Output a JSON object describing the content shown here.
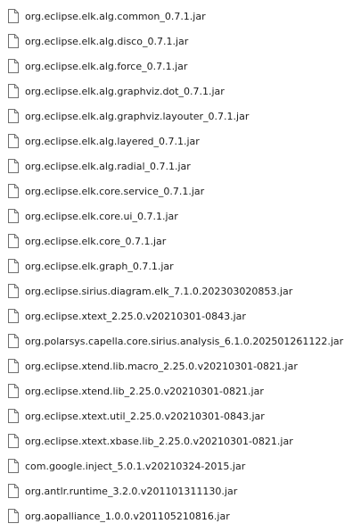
{
  "files": [
    {
      "name": "org.eclipse.elk.alg.common_0.7.1.jar",
      "icon": "file-icon"
    },
    {
      "name": "org.eclipse.elk.alg.disco_0.7.1.jar",
      "icon": "file-icon"
    },
    {
      "name": "org.eclipse.elk.alg.force_0.7.1.jar",
      "icon": "file-icon"
    },
    {
      "name": "org.eclipse.elk.alg.graphviz.dot_0.7.1.jar",
      "icon": "file-icon"
    },
    {
      "name": "org.eclipse.elk.alg.graphviz.layouter_0.7.1.jar",
      "icon": "file-icon"
    },
    {
      "name": "org.eclipse.elk.alg.layered_0.7.1.jar",
      "icon": "file-icon"
    },
    {
      "name": "org.eclipse.elk.alg.radial_0.7.1.jar",
      "icon": "file-icon"
    },
    {
      "name": "org.eclipse.elk.core.service_0.7.1.jar",
      "icon": "file-icon"
    },
    {
      "name": "org.eclipse.elk.core.ui_0.7.1.jar",
      "icon": "file-icon"
    },
    {
      "name": "org.eclipse.elk.core_0.7.1.jar",
      "icon": "file-icon"
    },
    {
      "name": "org.eclipse.elk.graph_0.7.1.jar",
      "icon": "file-icon"
    },
    {
      "name": "org.eclipse.sirius.diagram.elk_7.1.0.202303020853.jar",
      "icon": "file-icon"
    },
    {
      "name": "org.eclipse.xtext_2.25.0.v20210301-0843.jar",
      "icon": "file-icon"
    },
    {
      "name": "org.polarsys.capella.core.sirius.analysis_6.1.0.202501261122.jar",
      "icon": "file-icon"
    },
    {
      "name": "org.eclipse.xtend.lib.macro_2.25.0.v20210301-0821.jar",
      "icon": "file-icon"
    },
    {
      "name": "org.eclipse.xtend.lib_2.25.0.v20210301-0821.jar",
      "icon": "file-icon"
    },
    {
      "name": "org.eclipse.xtext.util_2.25.0.v20210301-0843.jar",
      "icon": "file-icon"
    },
    {
      "name": "org.eclipse.xtext.xbase.lib_2.25.0.v20210301-0821.jar",
      "icon": "file-icon"
    },
    {
      "name": "com.google.inject_5.0.1.v20210324-2015.jar",
      "icon": "file-icon"
    },
    {
      "name": "org.antlr.runtime_3.2.0.v201101311130.jar",
      "icon": "file-icon"
    },
    {
      "name": "org.aopalliance_1.0.0.v201105210816.jar",
      "icon": "file-icon"
    }
  ],
  "colors": {
    "text": "#1b1b1b",
    "icon_stroke": "#6f6f6f",
    "icon_fill": "#ffffff",
    "background": "#ffffff"
  }
}
